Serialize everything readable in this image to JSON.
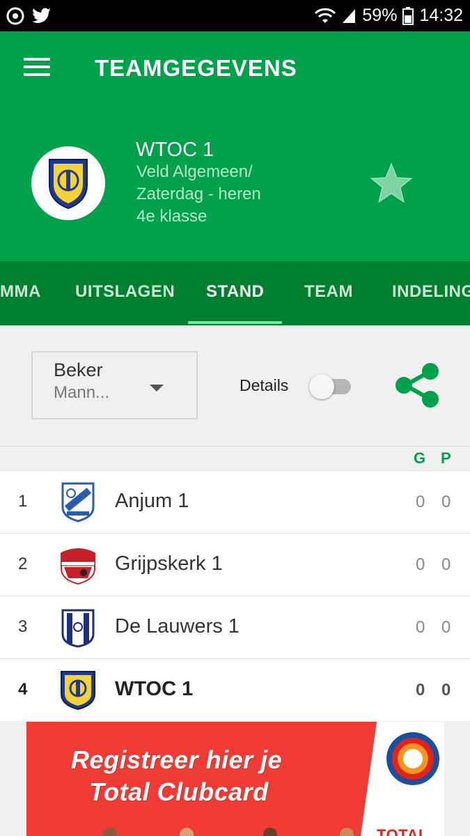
{
  "status_bar": {
    "battery": "59%",
    "time": "14:32"
  },
  "header": {
    "title": "TEAMGEGEVENS",
    "team_name": "WTOC 1",
    "team_sub_1": "Veld Algemeen/",
    "team_sub_2": "Zaterdag - heren",
    "team_sub_3": "4e klasse"
  },
  "tabs": [
    {
      "label": "MMA"
    },
    {
      "label": "UITSLAGEN"
    },
    {
      "label": "STAND",
      "active": true
    },
    {
      "label": "TEAM"
    },
    {
      "label": "INDELING"
    }
  ],
  "filter": {
    "select_line1": "Beker",
    "select_line2": "Mann...",
    "details_label": "Details",
    "details_on": false
  },
  "table": {
    "headers": {
      "g": "G",
      "p": "P"
    },
    "rows": [
      {
        "pos": "1",
        "name": "Anjum 1",
        "g": "0",
        "p": "0"
      },
      {
        "pos": "2",
        "name": "Grijpskerk 1",
        "g": "0",
        "p": "0"
      },
      {
        "pos": "3",
        "name": "De Lauwers 1",
        "g": "0",
        "p": "0"
      },
      {
        "pos": "4",
        "name": "WTOC 1",
        "g": "0",
        "p": "0"
      }
    ]
  },
  "ad": {
    "line1": "Registreer hier je",
    "line2": "Total Clubcard",
    "brand": "TOTAL"
  },
  "colors": {
    "brand_green": "#00a14b",
    "tab_bar": "#00802f",
    "ad_red": "#ef3b33"
  },
  "icons": [
    "menu-icon",
    "star-icon",
    "share-icon",
    "wifi-icon",
    "signal-icon",
    "battery-icon",
    "twitter-icon"
  ]
}
